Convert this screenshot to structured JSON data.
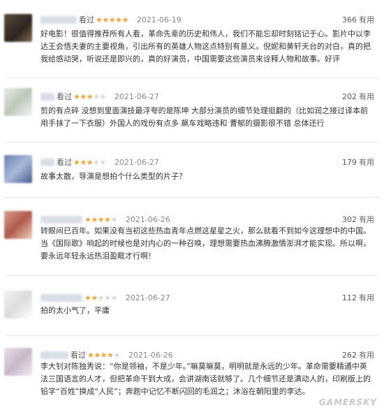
{
  "useful_label": "有用",
  "seen_label": "看过",
  "colors": {
    "star": "#f3a536",
    "star_empty": "#d9d9d9"
  },
  "reviews": [
    {
      "date": "2021-06-19",
      "rating": 5,
      "useful_count": "366",
      "text": "好电影！很值得推荐所有人看，革命先辈的历史和伟人，我们不能忘却时刻铭记于心。影片中以李达王会悟夫妻的主要视角，引出所有的英雄人物这点特别有意义。倪妮和黄轩天台的对白，真的把我给感动哭，听说还是即兴的，真的好演员，中国需要这些演员来诠释人物和故事。好评"
    },
    {
      "date": "2021-06-27",
      "rating": 3,
      "useful_count": "202",
      "text": "剪的有点碎 没想到里面演技最浮夸的是陈坤 大部分演员的细节处理挺翻的（比如润之接过译本前用手抹了一下衣服）外国人的戏份有点多 飙车戏略违和 曹郁的摄影很不错 总体还行"
    },
    {
      "date": "2021-06-27",
      "rating": 3,
      "useful_count": "179",
      "text": "故事太散，导演是想拍个什么类型的片子？"
    },
    {
      "date": "2021-06-26",
      "rating": 4,
      "useful_count": "302",
      "text": "转眼间已百年。如果没有当初这些热血青年点燃这星星之火，那么就看不到如今这理想中的中国。当《国际歌》响起的时候也是对内心的一种召唤，理想需要热血沸腾激情澎湃才能实现。所以啊，要永远年轻永远热泪盈眶才行啊！"
    },
    {
      "date": "2021-06-27",
      "rating": 2,
      "useful_count": "112",
      "text": "拍的太小气了，平庸"
    },
    {
      "date": "2021-06-26",
      "rating": 4,
      "useful_count": "262",
      "text": "李大钊对陈独秀说：“你是领袖，不是少年。”嘛莫嘛莫，明明就是永远的少年。革命需要精通中英法三国语言的人才，但把革命干到大成，会讲湖南话就够了。几个细节还是满动人的，印刷版上的铅字“百姓”换成“人民”；奔跑中记忆不断闪回的毛润之；沐浴在朝阳里的李达。"
    }
  ],
  "watermark": "GAMERSKY"
}
